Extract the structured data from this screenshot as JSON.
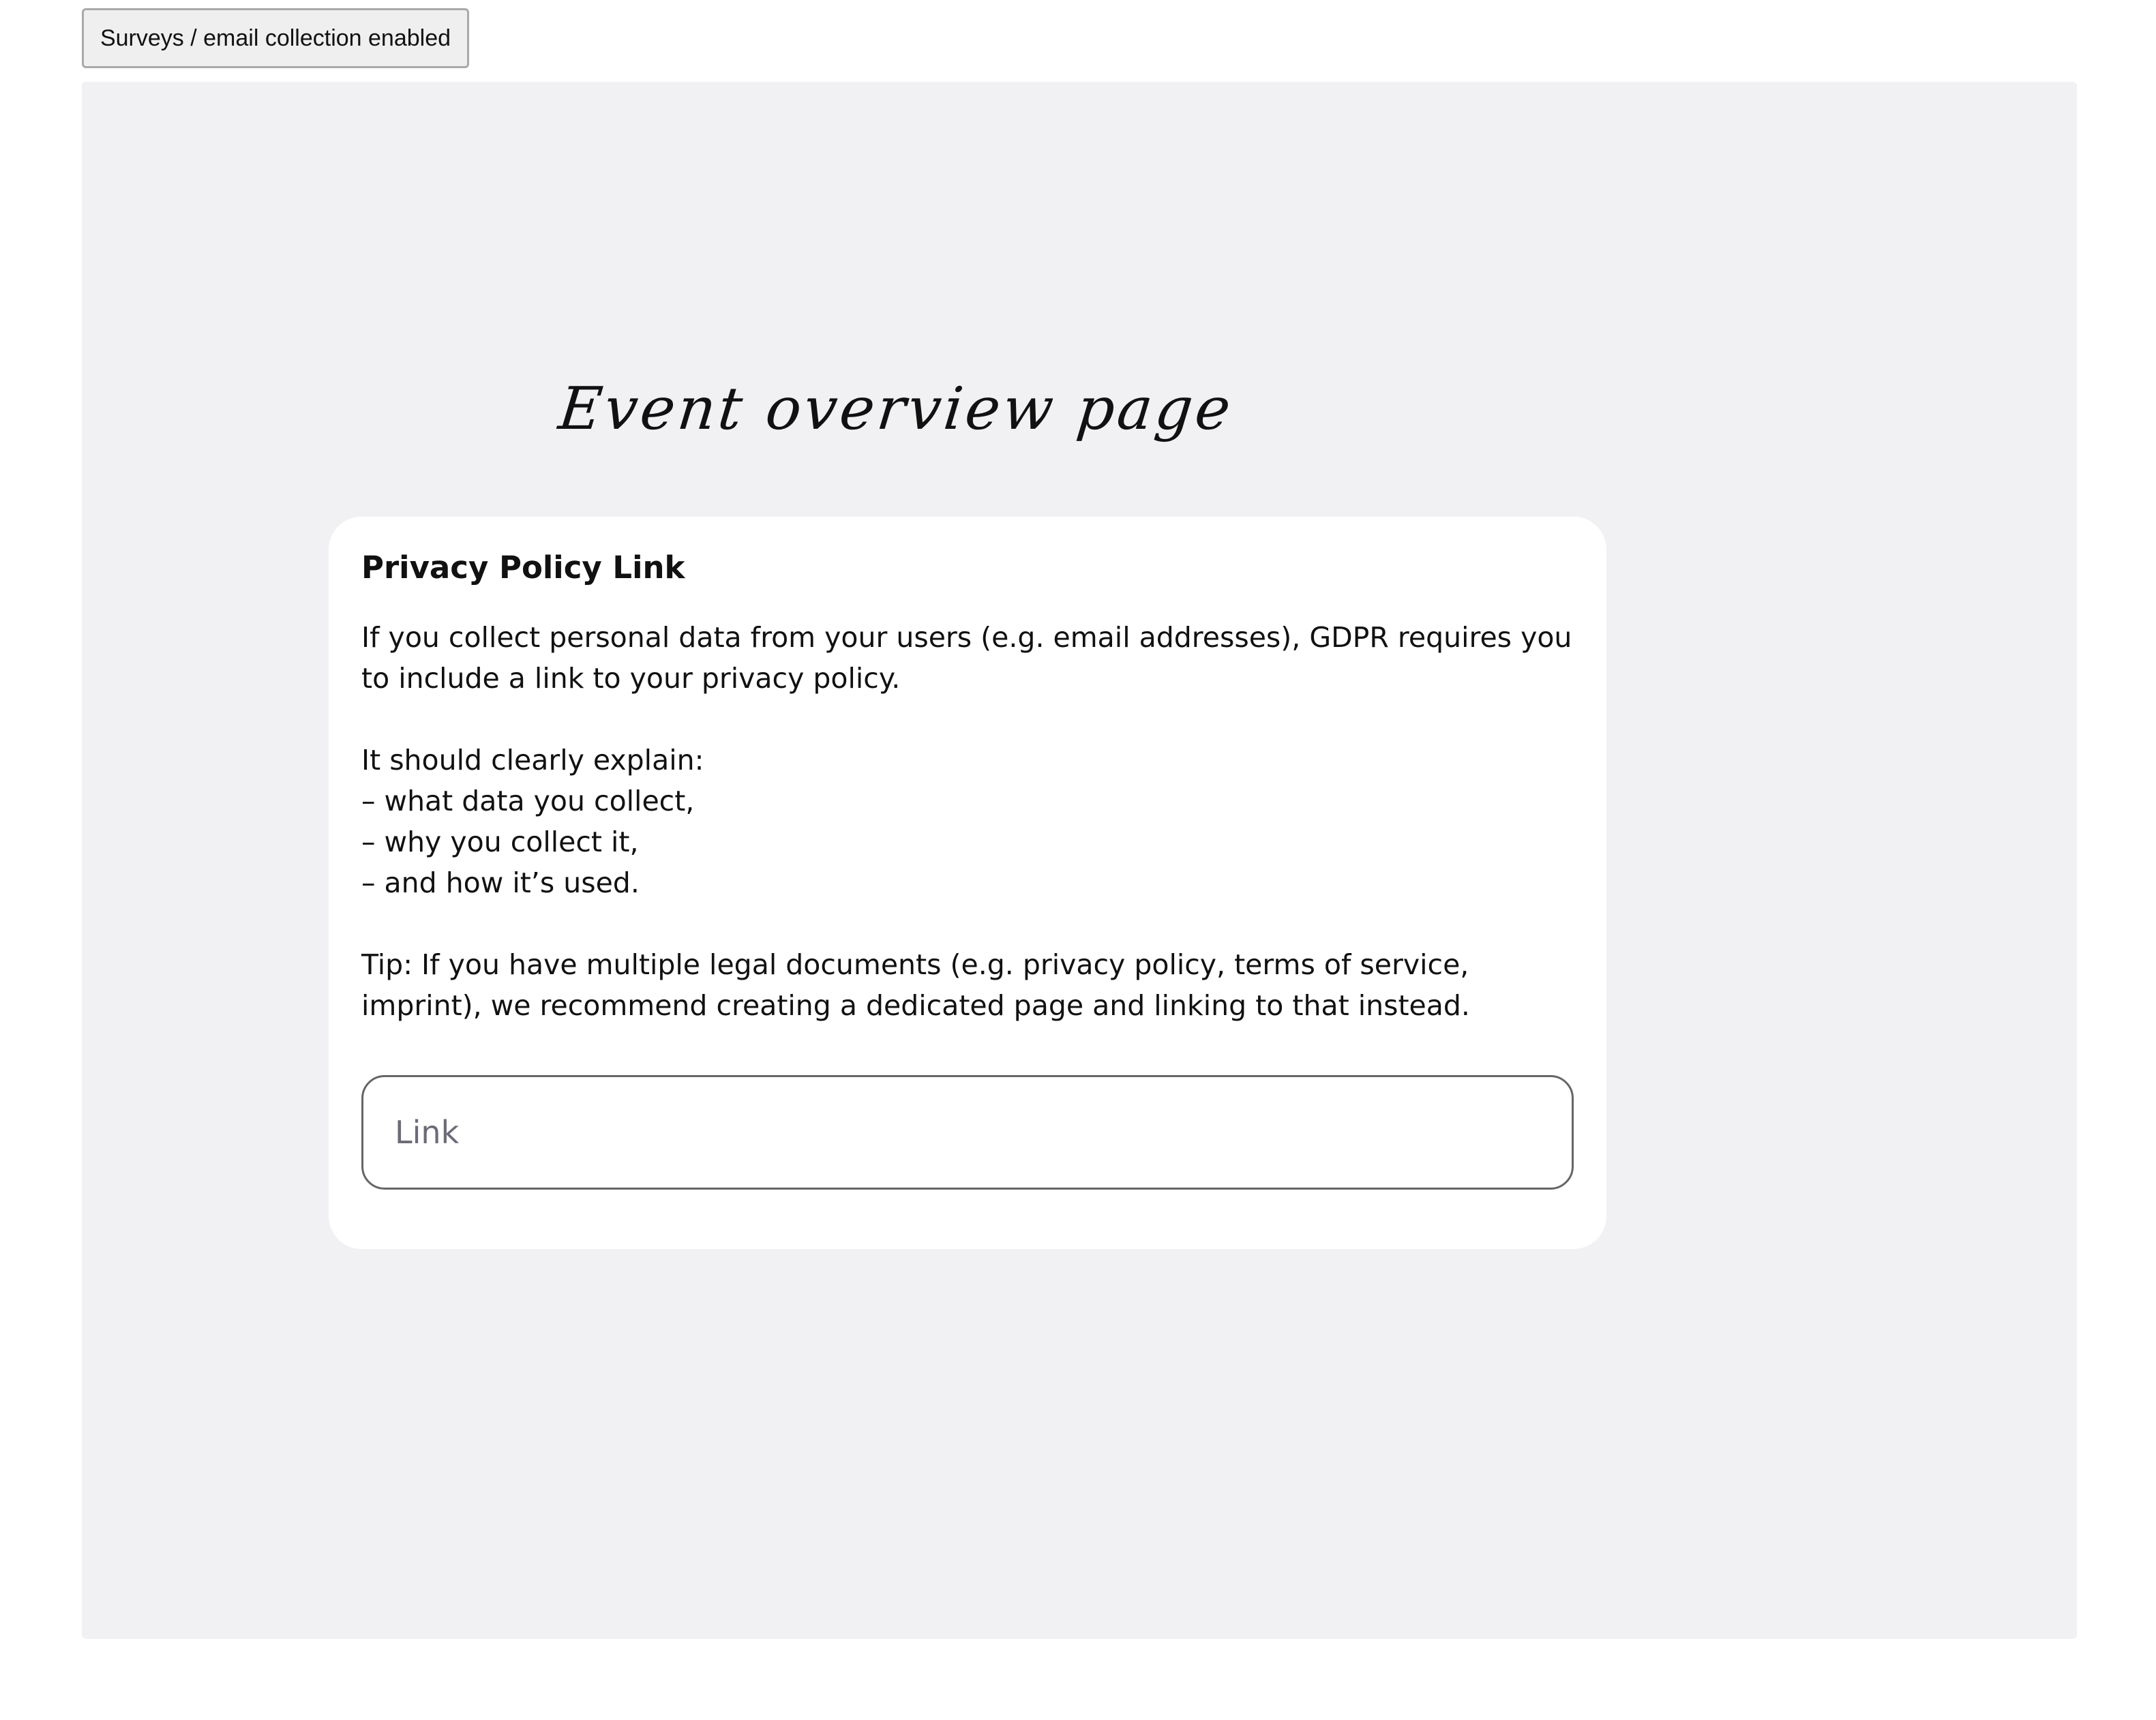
{
  "toolbar": {
    "toggle_label": "Surveys / email collection enabled"
  },
  "canvas": {
    "page_label": "Event overview page"
  },
  "privacy_card": {
    "title": "Privacy Policy Link",
    "intro": "If you collect personal data from your users (e.g. email addresses), GDPR requires you to include a link to your privacy policy.",
    "explain": "It should clearly explain:\n– what data you collect,\n– why you collect it,\n– and how it’s used.",
    "tip": "Tip: If you have multiple legal documents (e.g. privacy policy, terms of service, imprint), we recommend creating a dedicated page and linking to that instead.",
    "link_input": {
      "placeholder": "Link",
      "value": ""
    }
  }
}
